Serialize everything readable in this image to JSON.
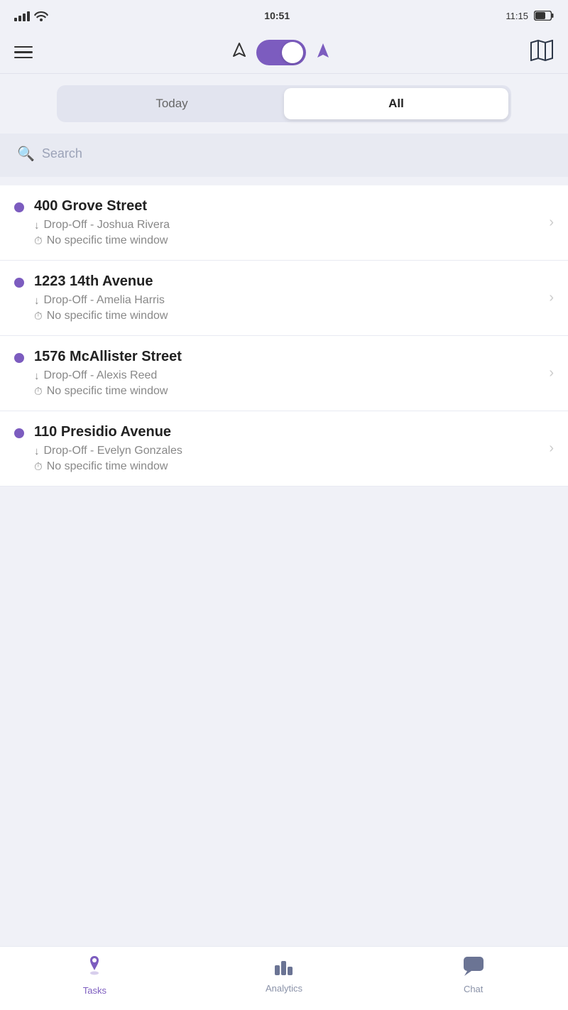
{
  "statusBar": {
    "time": "10:51",
    "timeRight": "11:15"
  },
  "topNav": {
    "toggleState": "on"
  },
  "segmentControl": {
    "options": [
      "Today",
      "All"
    ],
    "activeIndex": 1
  },
  "search": {
    "placeholder": "Search"
  },
  "deliveries": [
    {
      "address": "400 Grove Street",
      "type": "Drop-Off",
      "person": "Joshua Rivera",
      "timeWindow": "No specific time window"
    },
    {
      "address": "1223 14th Avenue",
      "type": "Drop-Off",
      "person": "Amelia Harris",
      "timeWindow": "No specific time window"
    },
    {
      "address": "1576 McAllister Street",
      "type": "Drop-Off",
      "person": "Alexis Reed",
      "timeWindow": "No specific time window"
    },
    {
      "address": "110 Presidio Avenue",
      "type": "Drop-Off",
      "person": "Evelyn Gonzales",
      "timeWindow": "No specific time window"
    }
  ],
  "bottomNav": {
    "tabs": [
      {
        "id": "tasks",
        "label": "Tasks",
        "icon": "📍",
        "active": true
      },
      {
        "id": "analytics",
        "label": "Analytics",
        "icon": "📊",
        "active": false
      },
      {
        "id": "chat",
        "label": "Chat",
        "icon": "💬",
        "active": false
      }
    ]
  }
}
